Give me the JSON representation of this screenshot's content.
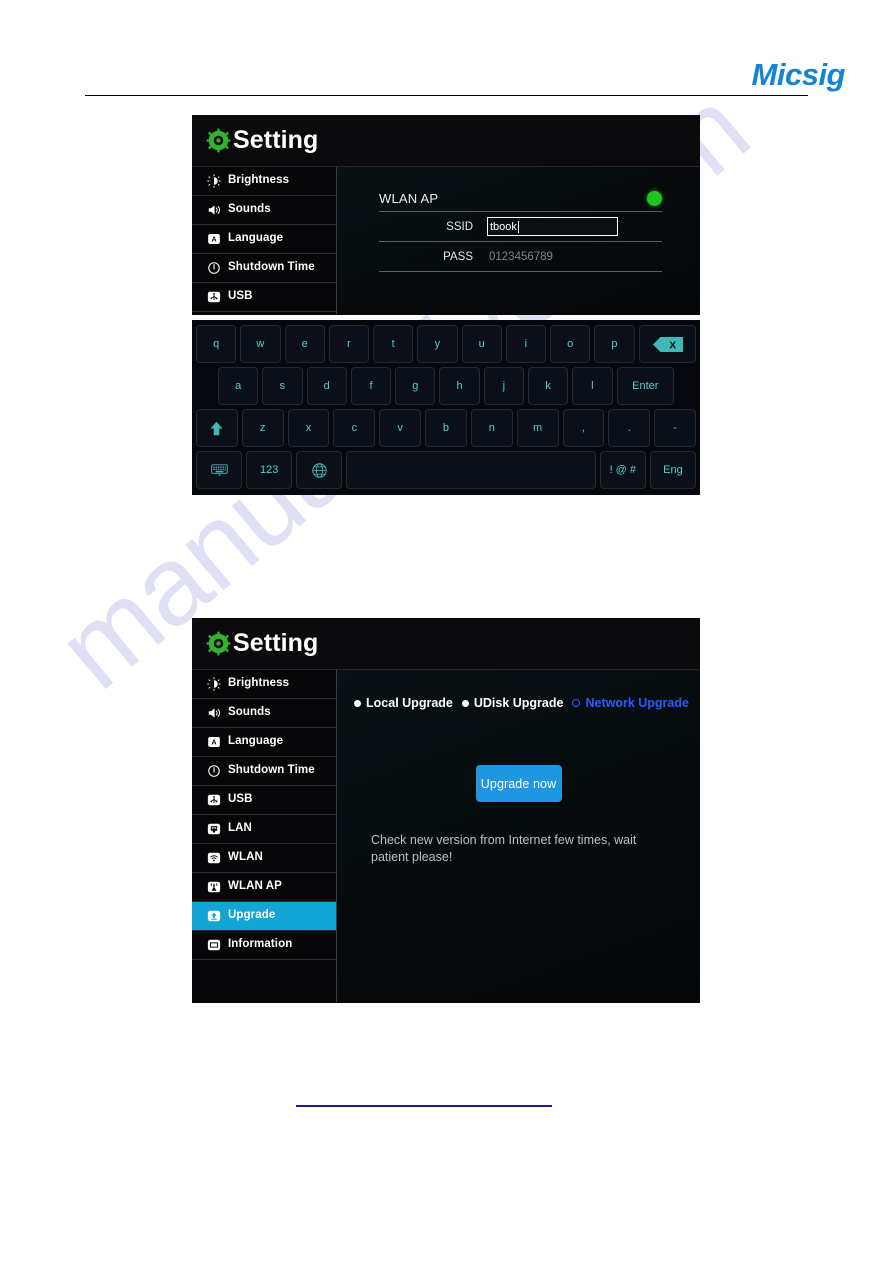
{
  "page": {
    "brand": "Micsig",
    "watermark_text": "manualshive.com"
  },
  "colors": {
    "brand_blue": "#1383d6",
    "accent_cyan": "#12a5d6",
    "key_text": "#54cfc9",
    "led_green": "#23c223",
    "button_blue": "#2196e0",
    "highlight_blue": "#2a5bff",
    "gear_green": "#33b22e"
  },
  "panel_one": {
    "title": "Setting",
    "title_icon": "gear-icon",
    "sidebar": {
      "items": [
        {
          "label": "Brightness",
          "icon": "brightness-icon",
          "active": false
        },
        {
          "label": "Sounds",
          "icon": "speaker-icon",
          "active": false
        },
        {
          "label": "Language",
          "icon": "language-a-icon",
          "active": false
        },
        {
          "label": "Shutdown Time",
          "icon": "clock-power-icon",
          "active": false
        },
        {
          "label": "USB",
          "icon": "usb-icon",
          "active": false
        }
      ]
    },
    "wlan_ap": {
      "section_title": "WLAN AP",
      "status_indicator": "led-on-green",
      "fields": [
        {
          "label": "SSID",
          "value": "tbook",
          "type": "text-input",
          "focused": true
        },
        {
          "label": "PASS",
          "value": "0123456789",
          "type": "static-value",
          "focused": false
        }
      ]
    },
    "keyboard": {
      "row1": [
        "q",
        "w",
        "e",
        "r",
        "t",
        "y",
        "u",
        "i",
        "o",
        "p"
      ],
      "row1_extra": {
        "label": "X",
        "name": "backspace-key"
      },
      "row2": [
        "a",
        "s",
        "d",
        "f",
        "g",
        "h",
        "j",
        "k",
        "l"
      ],
      "row2_extra": {
        "label": "Enter",
        "name": "enter-key"
      },
      "row3_shift": {
        "label": "",
        "name": "shift-key"
      },
      "row3": [
        "z",
        "x",
        "c",
        "v",
        "b",
        "n",
        "m",
        ",",
        ".",
        "-"
      ],
      "row4": [
        {
          "label": "",
          "name": "hide-keyboard-key"
        },
        {
          "label": "123",
          "name": "numeric-key"
        },
        {
          "label": "",
          "name": "globe-language-key"
        },
        {
          "label": "",
          "name": "space-key"
        },
        {
          "label": "! @ #",
          "name": "symbols-key"
        },
        {
          "label": "Eng",
          "name": "input-language-key"
        }
      ]
    }
  },
  "panel_two": {
    "title": "Setting",
    "title_icon": "gear-icon",
    "sidebar": {
      "items": [
        {
          "label": "Brightness",
          "icon": "brightness-icon",
          "active": false
        },
        {
          "label": "Sounds",
          "icon": "speaker-icon",
          "active": false
        },
        {
          "label": "Language",
          "icon": "language-a-icon",
          "active": false
        },
        {
          "label": "Shutdown Time",
          "icon": "clock-power-icon",
          "active": false
        },
        {
          "label": "USB",
          "icon": "usb-icon",
          "active": false
        },
        {
          "label": "LAN",
          "icon": "lan-icon",
          "active": false
        },
        {
          "label": "WLAN",
          "icon": "wifi-icon",
          "active": false
        },
        {
          "label": "WLAN AP",
          "icon": "access-point-icon",
          "active": false
        },
        {
          "label": "Upgrade",
          "icon": "upload-icon",
          "active": true
        },
        {
          "label": "Information",
          "icon": "info-monitor-icon",
          "active": false
        }
      ]
    },
    "upgrade": {
      "options": [
        {
          "label": "Local Upgrade",
          "selected": false,
          "highlight": false
        },
        {
          "label": "UDisk Upgrade",
          "selected": false,
          "highlight": false
        },
        {
          "label": "Network Upgrade",
          "selected": true,
          "highlight": true
        }
      ],
      "button_label": "Upgrade now",
      "hint": "Check new version from Internet few times, wait patient please!"
    }
  }
}
